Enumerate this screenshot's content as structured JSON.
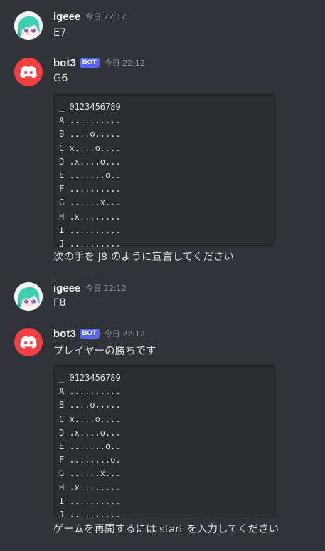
{
  "messages": [
    {
      "author": "igeee",
      "timestamp": "今日 22:12",
      "avatar": "anime-avatar",
      "text": "E7"
    },
    {
      "author": "bot3",
      "badge": "BOT",
      "timestamp": "今日 22:12",
      "avatar": "discord-logo",
      "text": "G6",
      "board": [
        "_ 0123456789",
        "A ..........",
        "B ....o.....",
        "C x....o....",
        "D .x....o...",
        "E .......o..",
        "F ..........",
        "G ......x...",
        "H .x........",
        "I ..........",
        "J .........."
      ],
      "followup": "次の手を J8 のように宣言してください"
    },
    {
      "author": "igeee",
      "timestamp": "今日 22:12",
      "avatar": "anime-avatar",
      "text": "F8"
    },
    {
      "author": "bot3",
      "badge": "BOT",
      "timestamp": "今日 22:12",
      "avatar": "discord-logo",
      "text": "プレイヤーの勝ちです",
      "board": [
        "_ 0123456789",
        "A ..........",
        "B ....o.....",
        "C x....o....",
        "D .x....o...",
        "E .......o..",
        "F ........o.",
        "G ......x...",
        "H .x........",
        "I ..........",
        "J .........."
      ],
      "followup": "ゲームを再開するには start を入力してください"
    }
  ],
  "colors": {
    "background": "#313338",
    "codeblock": "#2b2d31",
    "bot_badge": "#5865f2",
    "bot_avatar": "#f23f43",
    "username": "#f2f3f5",
    "timestamp": "#949ba4",
    "text": "#dbdee1"
  }
}
